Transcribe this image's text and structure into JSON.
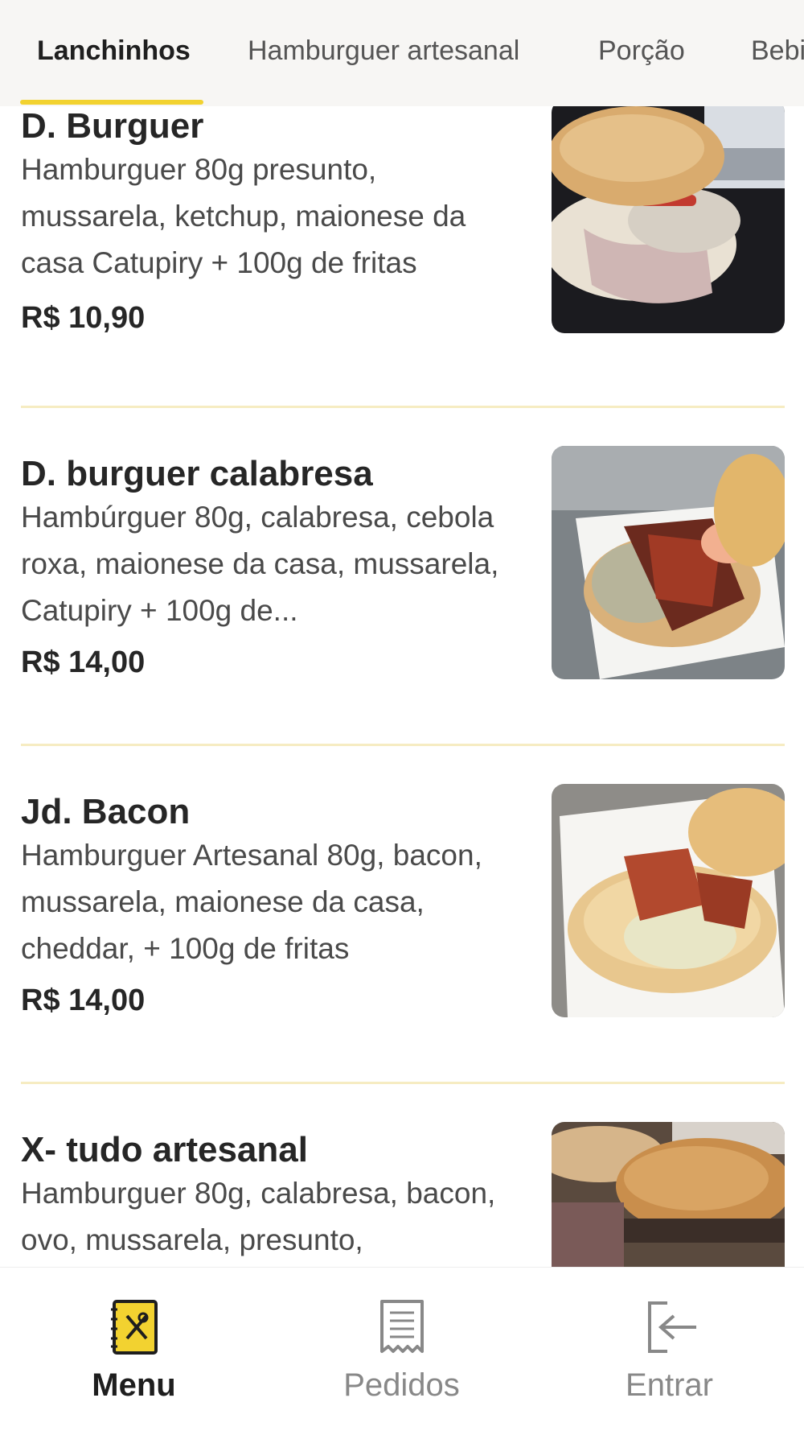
{
  "tabs": [
    {
      "label": "Lanchinhos",
      "active": true
    },
    {
      "label": "Hamburguer artesanal",
      "active": false
    },
    {
      "label": "Porção",
      "active": false
    },
    {
      "label": "Bebi",
      "active": false
    }
  ],
  "accent_color": "#f2d230",
  "items": [
    {
      "name": "D. Burguer",
      "description": "Hamburguer 80g presunto, mussarela, ketchup, maionese da casa Catupiry + 100g de fritas",
      "price": "R$ 10,90"
    },
    {
      "name": "D. burguer calabresa",
      "description": "Hambúrguer 80g, calabresa, cebola roxa, maionese da casa, mussarela, Catupiry + 100g de...",
      "price": "R$ 14,00"
    },
    {
      "name": "Jd. Bacon",
      "description": "Hamburguer Artesanal 80g, bacon, mussarela, maionese da casa, cheddar, + 100g de fritas",
      "price": "R$ 14,00"
    },
    {
      "name": "X- tudo artesanal",
      "description": "Hamburguer 80g, calabresa, bacon, ovo, mussarela, presunto,",
      "price": ""
    }
  ],
  "bottom_nav": [
    {
      "label": "Menu",
      "icon": "menu-book-icon",
      "active": true
    },
    {
      "label": "Pedidos",
      "icon": "receipt-icon",
      "active": false
    },
    {
      "label": "Entrar",
      "icon": "login-icon",
      "active": false
    }
  ]
}
